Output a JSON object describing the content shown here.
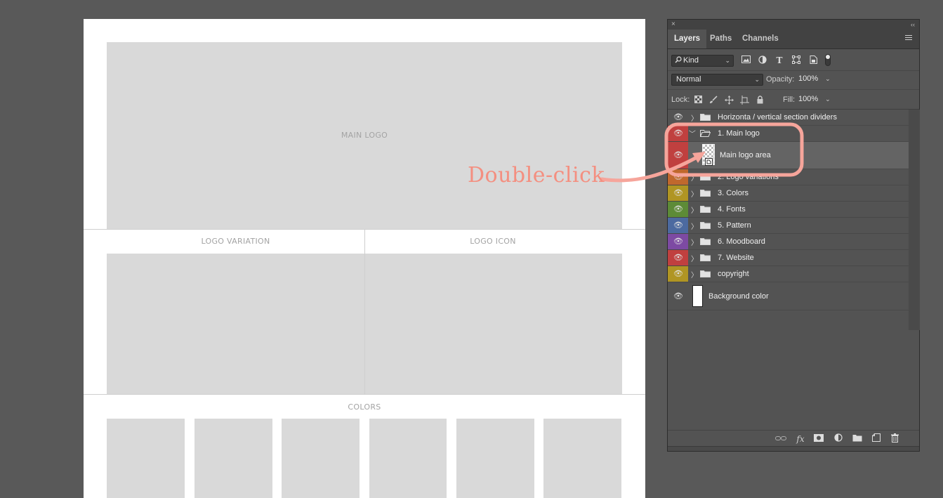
{
  "document": {
    "main_logo_label": "MAIN LOGO",
    "logo_variation_label": "LOGO VARIATION",
    "logo_icon_label": "LOGO ICON",
    "colors_label": "COLORS",
    "color_swatch_count": 6
  },
  "panel": {
    "close_glyph": "×",
    "collapse_glyph": "‹‹",
    "tabs": [
      {
        "label": "Layers",
        "active": true
      },
      {
        "label": "Paths",
        "active": false
      },
      {
        "label": "Channels",
        "active": false
      }
    ],
    "filter": {
      "kind_label": "Kind",
      "icons": [
        "image-filter-icon",
        "adjustment-filter-icon",
        "type-filter-icon",
        "shape-filter-icon",
        "smart-object-filter-icon"
      ]
    },
    "blend_mode": "Normal",
    "opacity_label": "Opacity:",
    "opacity_value": "100%",
    "lock_label": "Lock:",
    "lock_icons": [
      "lock-transparent-pixels-icon",
      "lock-image-pixels-icon",
      "lock-position-icon",
      "lock-artboard-icon",
      "lock-all-icon"
    ],
    "fill_label": "Fill:",
    "fill_value": "100%",
    "layers": [
      {
        "name": "Horizonta / vertical section dividers",
        "type": "group",
        "expanded": false,
        "color": ""
      },
      {
        "name": "1. Main logo",
        "type": "group",
        "expanded": true,
        "color": "#c0403f"
      },
      {
        "name": "Main logo area",
        "type": "smart-object",
        "color": "#c0403f",
        "child": true
      },
      {
        "name": "2. Logo variations",
        "type": "group",
        "expanded": false,
        "color": "#c0682d"
      },
      {
        "name": "3. Colors",
        "type": "group",
        "expanded": false,
        "color": "#b09523"
      },
      {
        "name": "4. Fonts",
        "type": "group",
        "expanded": false,
        "color": "#5d8b37"
      },
      {
        "name": "5. Pattern",
        "type": "group",
        "expanded": false,
        "color": "#4c6aa0"
      },
      {
        "name": "6. Moodboard",
        "type": "group",
        "expanded": false,
        "color": "#7d4aa3"
      },
      {
        "name": "7. Website",
        "type": "group",
        "expanded": false,
        "color": "#c0403f"
      },
      {
        "name": "copyright",
        "type": "group",
        "expanded": false,
        "color": "#b09523"
      },
      {
        "name": "Background color",
        "type": "background",
        "color": ""
      }
    ],
    "bottom_icons": [
      "link-layers-icon",
      "fx-icon",
      "layer-mask-icon",
      "adjustment-layer-icon",
      "new-group-icon",
      "new-layer-icon",
      "trash-icon"
    ]
  },
  "annotation": {
    "text": "Double-click",
    "color": "#f48f80"
  }
}
